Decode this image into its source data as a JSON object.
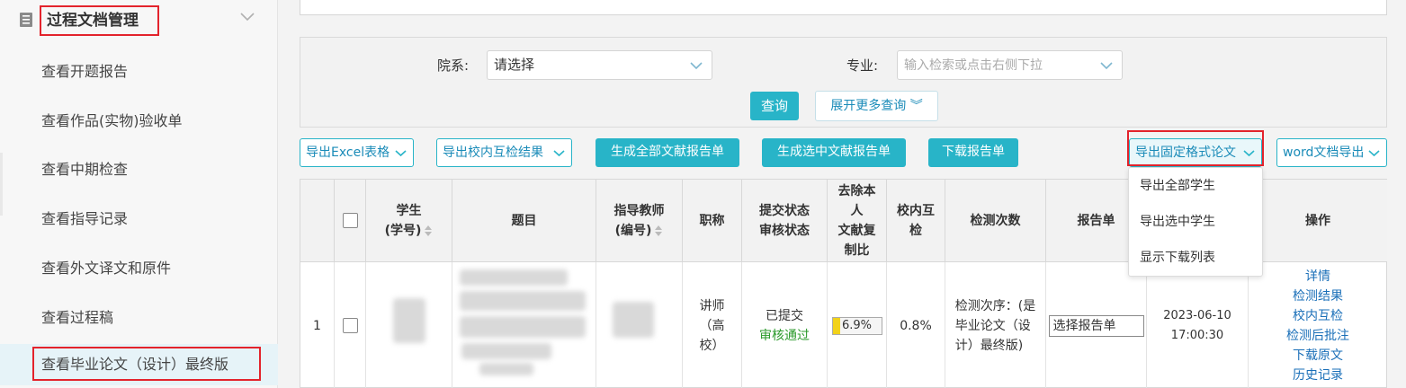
{
  "sidebar": {
    "group_title": "过程文档管理",
    "items": [
      {
        "label": "查看开题报告"
      },
      {
        "label": "查看作品(实物)验收单"
      },
      {
        "label": "查看中期检查"
      },
      {
        "label": "查看指导记录"
      },
      {
        "label": "查看外文译文和原件"
      },
      {
        "label": "查看过程稿"
      },
      {
        "label": "查看毕业论文（设计）最终版"
      }
    ]
  },
  "filter": {
    "department_label": "院系:",
    "department_value": "请选择",
    "major_label": "专业:",
    "major_placeholder": "输入检索或点击右侧下拉",
    "query_button": "查询",
    "more_button": "展开更多查询 ︾"
  },
  "toolbar": {
    "export_excel": "导出Excel表格",
    "export_campus_check": "导出校内互检结果",
    "gen_all_report": "生成全部文献报告单",
    "gen_selected_report": "生成选中文献报告单",
    "download_report": "下载报告单",
    "export_fixed_format": "导出固定格式论文",
    "word_export": "word文档导出"
  },
  "dropdown": {
    "items": [
      "导出全部学生",
      "导出选中学生",
      "显示下载列表"
    ]
  },
  "table": {
    "headers": {
      "student_line1": "学生",
      "student_line2": "(学号)",
      "title": "题目",
      "advisor_line1": "指导教师",
      "advisor_line2": "(编号)",
      "rank": "职称",
      "status_line1": "提交状态",
      "status_line2": "审核状态",
      "dup_line1": "去除本",
      "dup_line2": "人",
      "dup_line3": "文献复",
      "dup_line4": "制比",
      "campus_line1": "校内互",
      "campus_line2": "检",
      "check_count": "检测次数",
      "report": "报告单",
      "actions": "操作"
    },
    "row": {
      "index": "1",
      "rank_line1": "讲师",
      "rank_line2": "（高",
      "rank_line3": "校）",
      "submit_status": "已提交",
      "review_status": "审核通过",
      "dup_ratio": "6.9%",
      "dup_ratio_value": 6.9,
      "campus_check": "0.8%",
      "check_line1": "检测次序：(是",
      "check_line2": "毕业论文（设",
      "check_line3": "计）最终版)",
      "report_select": "选择报告单",
      "date": "2023-06-10",
      "time": "17:00:30",
      "actions": [
        "详情",
        "检测结果",
        "校内互检",
        "检测后批注",
        "下载原文",
        "历史记录"
      ]
    }
  },
  "colors": {
    "accent": "#28b4c8",
    "highlight": "#e3232c",
    "link": "#1a6fb8",
    "approved": "#2b9a2b",
    "progress": "#f2d21a"
  }
}
